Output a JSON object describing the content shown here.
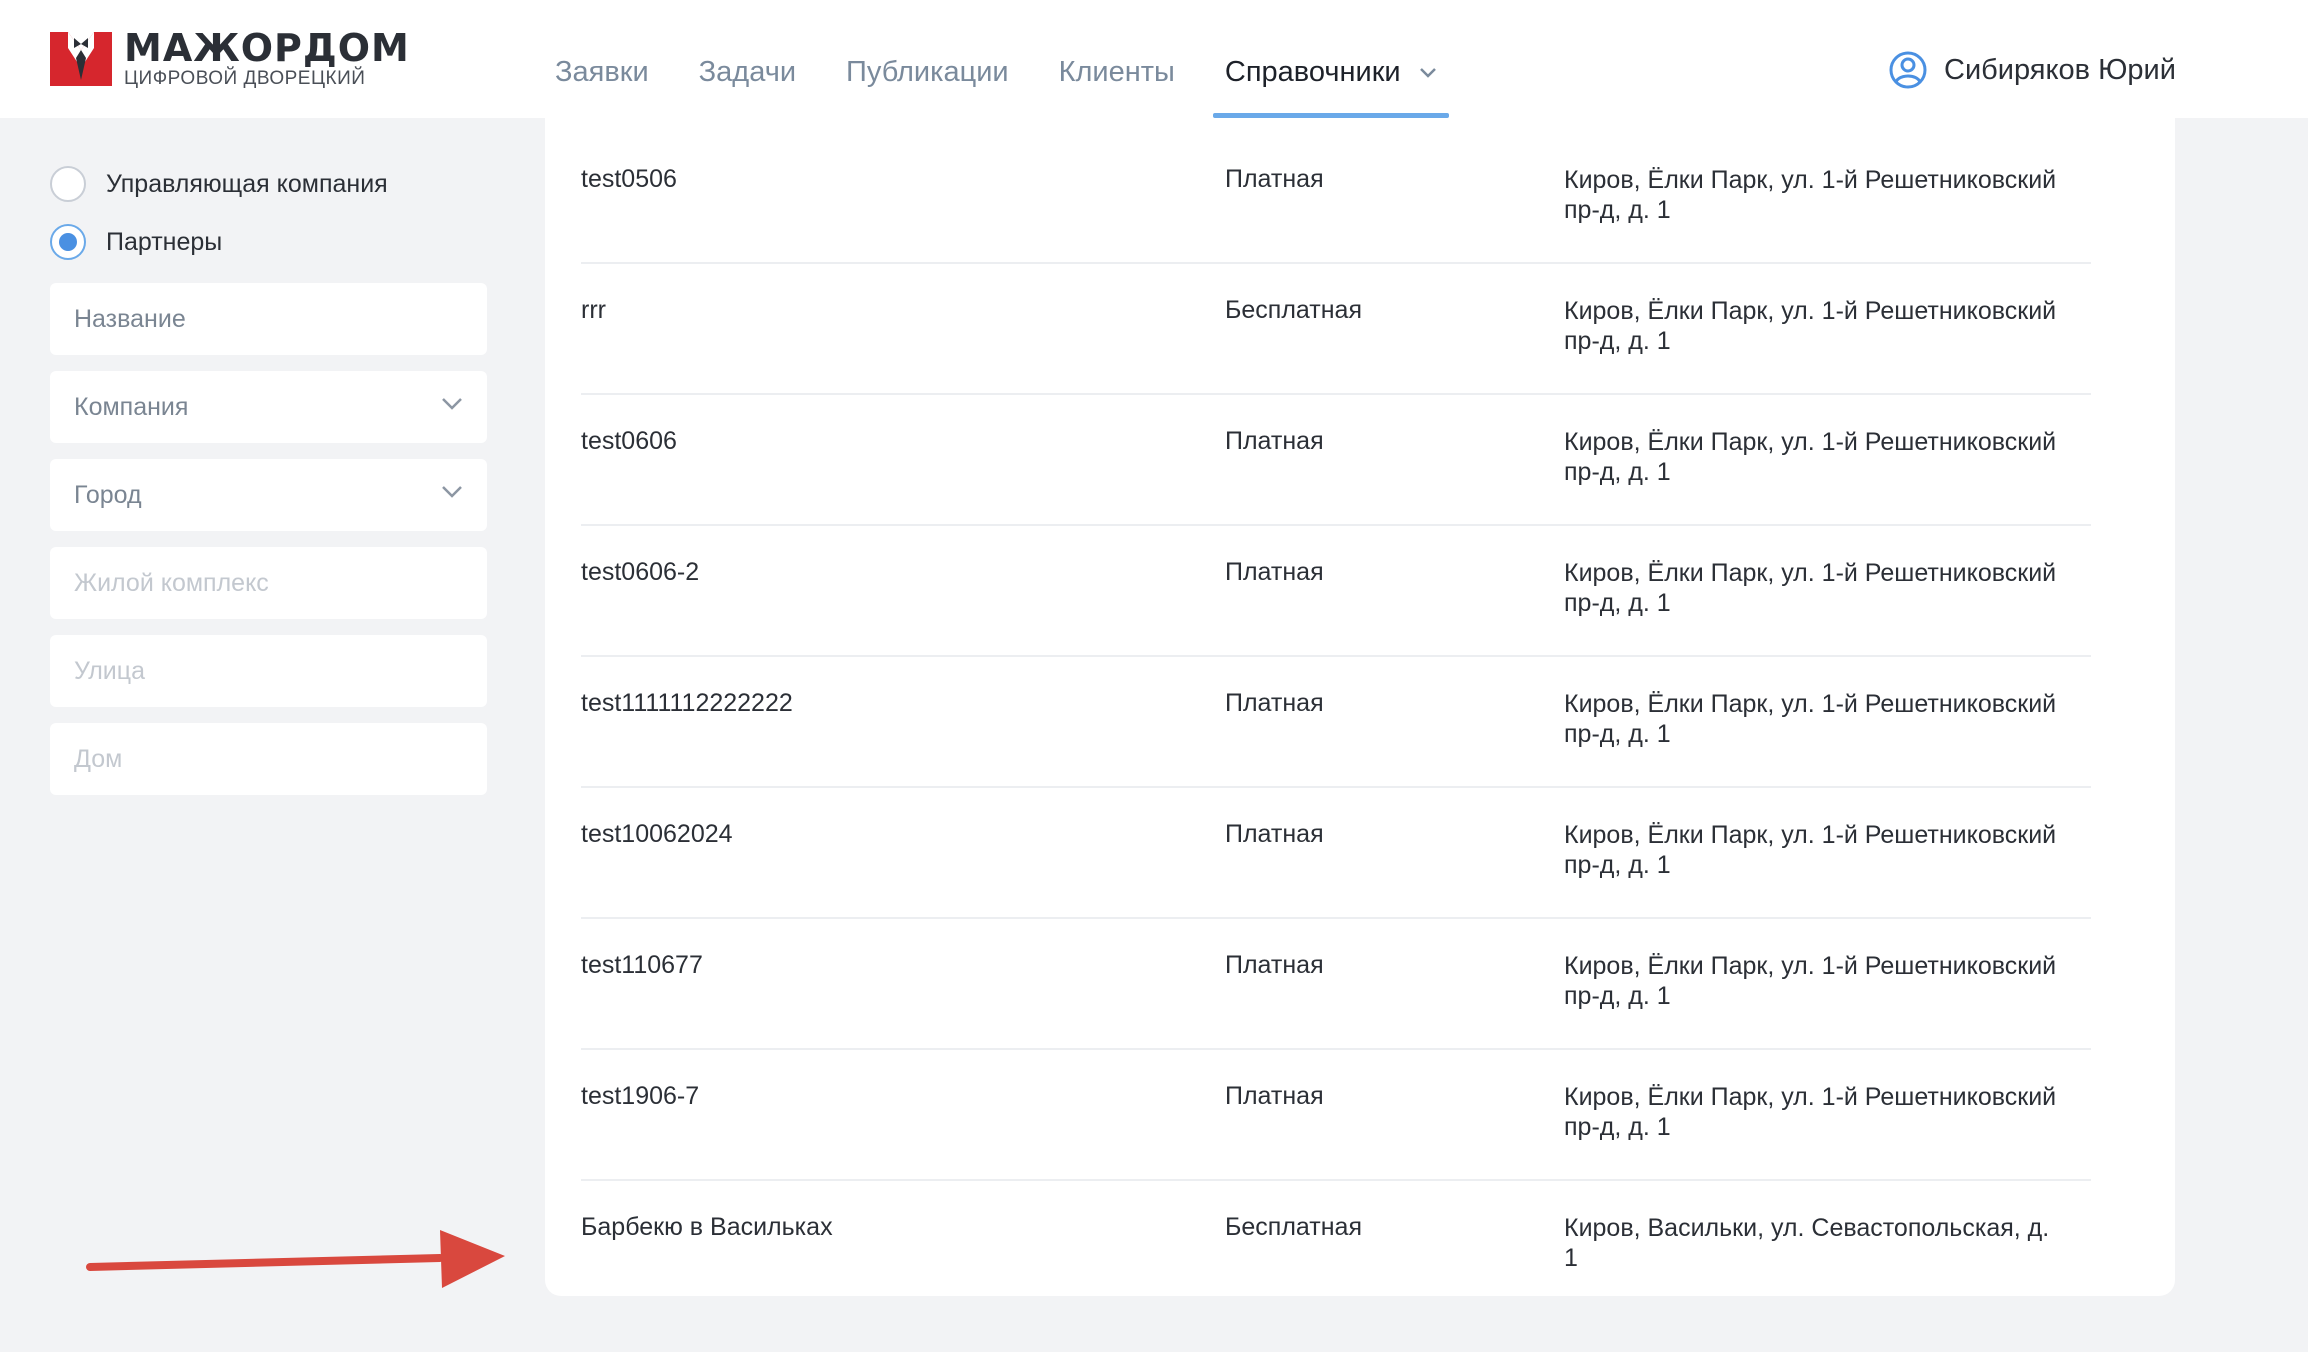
{
  "app": {
    "logo_title": "МАЖОРДОМ",
    "logo_subtitle": "ЦИФРОВОЙ ДВОРЕЦКИЙ"
  },
  "nav": {
    "items": [
      {
        "label": "Заявки"
      },
      {
        "label": "Задачи"
      },
      {
        "label": "Публикации"
      },
      {
        "label": "Клиенты"
      },
      {
        "label": "Справочники",
        "active": true
      }
    ]
  },
  "user": {
    "name": "Сибиряков Юрий"
  },
  "filters": {
    "radios": [
      {
        "label": "Управляющая компания",
        "checked": false
      },
      {
        "label": "Партнеры",
        "checked": true
      }
    ],
    "name_placeholder": "Название",
    "company_label": "Компания",
    "city_label": "Город",
    "complex_placeholder": "Жилой комплекс",
    "street_placeholder": "Улица",
    "house_placeholder": "Дом"
  },
  "table": {
    "rows": [
      {
        "name": "test0506",
        "type": "Платная",
        "address": "Киров, Ёлки Парк, ул. 1-й Решетниковский пр-д, д. 1"
      },
      {
        "name": "rrr",
        "type": "Бесплатная",
        "address": "Киров, Ёлки Парк, ул. 1-й Решетниковский пр-д, д. 1"
      },
      {
        "name": "test0606",
        "type": "Платная",
        "address": "Киров, Ёлки Парк, ул. 1-й Решетниковский пр-д, д. 1"
      },
      {
        "name": "test0606-2",
        "type": "Платная",
        "address": "Киров, Ёлки Парк, ул. 1-й Решетниковский пр-д, д. 1"
      },
      {
        "name": "test1111112222222",
        "type": "Платная",
        "address": "Киров, Ёлки Парк, ул. 1-й Решетниковский пр-д, д. 1"
      },
      {
        "name": "test10062024",
        "type": "Платная",
        "address": "Киров, Ёлки Парк, ул. 1-й Решетниковский пр-д, д. 1"
      },
      {
        "name": "test110677",
        "type": "Платная",
        "address": "Киров, Ёлки Парк, ул. 1-й Решетниковский пр-д, д. 1"
      },
      {
        "name": "test1906-7",
        "type": "Платная",
        "address": "Киров, Ёлки Парк, ул. 1-й Решетниковский пр-д, д. 1"
      },
      {
        "name": "Барбекю в Васильках",
        "type": "Бесплатная",
        "address": "Киров, Васильки, ул. Севастопольская, д. 1"
      }
    ]
  },
  "colors": {
    "accent": "#4a90e2",
    "logo_red": "#d6262d",
    "annotation_arrow": "#d9483e"
  },
  "icons": {
    "logo": "butler-bowtie-logo",
    "user": "user-circle-icon",
    "dropdown": "chevron-down-icon",
    "annotation": "arrow-right-annotation"
  }
}
